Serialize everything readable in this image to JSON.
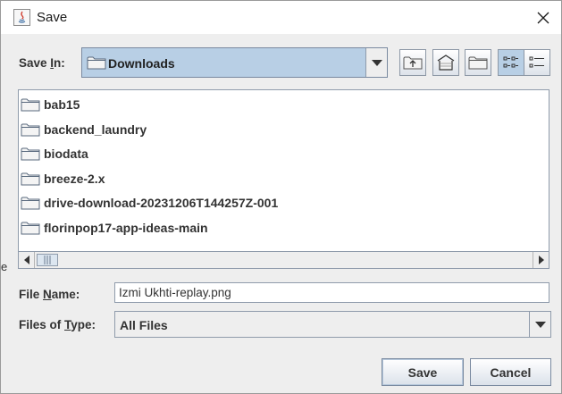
{
  "window": {
    "title": "Save"
  },
  "icons": {
    "app": "java-icon",
    "close": "close-icon",
    "folder": "folder-icon",
    "up_folder": "up-folder-icon",
    "home": "home-icon",
    "new_folder": "new-folder-icon",
    "list_view": "list-view-icon",
    "details_view": "details-view-icon"
  },
  "save_in": {
    "label_pre": "Save ",
    "label_mnemonic": "I",
    "label_post": "n:",
    "value": "Downloads"
  },
  "files": [
    {
      "name": "bab15"
    },
    {
      "name": "backend_laundry"
    },
    {
      "name": "biodata"
    },
    {
      "name": "breeze-2.x"
    },
    {
      "name": "drive-download-20231206T144257Z-001"
    },
    {
      "name": "florinpop17-app-ideas-main"
    }
  ],
  "file_name": {
    "label_pre": "File ",
    "label_mnemonic": "N",
    "label_post": "ame:",
    "value": "Izmi Ukhti-replay.png"
  },
  "files_of_type": {
    "label_pre": "Files of ",
    "label_mnemonic": "T",
    "label_post": "ype:",
    "value": "All Files"
  },
  "buttons": {
    "save": "Save",
    "cancel": "Cancel"
  },
  "background_text": "e",
  "colors": {
    "selection": "#b8cfe5",
    "border": "#8f9bab",
    "dialog_bg": "#eeeeee"
  }
}
